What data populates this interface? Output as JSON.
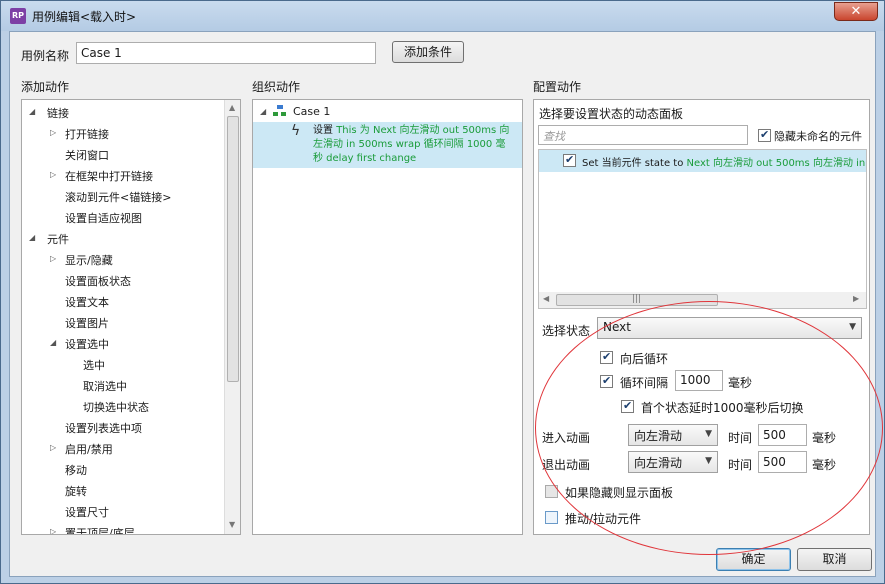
{
  "window": {
    "title": "用例编辑<载入时>",
    "app_icon": "RP",
    "close_glyph": "✕"
  },
  "case_name": {
    "label": "用例名称",
    "value": "Case 1",
    "add_condition": "添加条件"
  },
  "left": {
    "header": "添加动作",
    "items": [
      "链接",
      "打开链接",
      "关闭窗口",
      "在框架中打开链接",
      "滚动到元件<锚链接>",
      "设置自适应视图",
      "元件",
      "显示/隐藏",
      "设置面板状态",
      "设置文本",
      "设置图片",
      "设置选中",
      "选中",
      "取消选中",
      "切换选中状态",
      "设置列表选中项",
      "启用/禁用",
      "移动",
      "旋转",
      "设置尺寸",
      "置于顶层/底层"
    ]
  },
  "middle": {
    "header": "组织动作",
    "case": "Case 1",
    "action_prefix": "设置",
    "action_line1": "This 为 Next 向左滑动 out 500ms 向",
    "action_line2": "左滑动 in 500ms wrap 循环间隔 1000 毫",
    "action_line3": "秒 delay first change"
  },
  "right": {
    "header": "配置动作",
    "choose_panel": "选择要设置状态的动态面板",
    "search_placeholder": "查找",
    "hide_unnamed": "隐藏未命名的元件",
    "row_prefix": "Set 当前元件 state to",
    "row_suffix": "Next 向左滑动 out 500ms 向左滑动 in",
    "state_label": "选择状态",
    "state_value": "Next",
    "wrap_back": "向后循环",
    "loop_interval": "循环间隔",
    "loop_value": "1000",
    "ms": "毫秒",
    "first_delay": "首个状态延时1000毫秒后切换",
    "enter_anim": "进入动画",
    "exit_anim": "退出动画",
    "anim_value": "向左滑动",
    "time": "时间",
    "time_value": "500",
    "show_if_hidden": "如果隐藏则显示面板",
    "push_pull": "推动/拉动元件"
  },
  "footer": {
    "ok": "确定",
    "cancel": "取消"
  },
  "colors": {
    "green": "#1a9c3a",
    "selection": "#cce8f5",
    "annotation": "#e0353a"
  }
}
